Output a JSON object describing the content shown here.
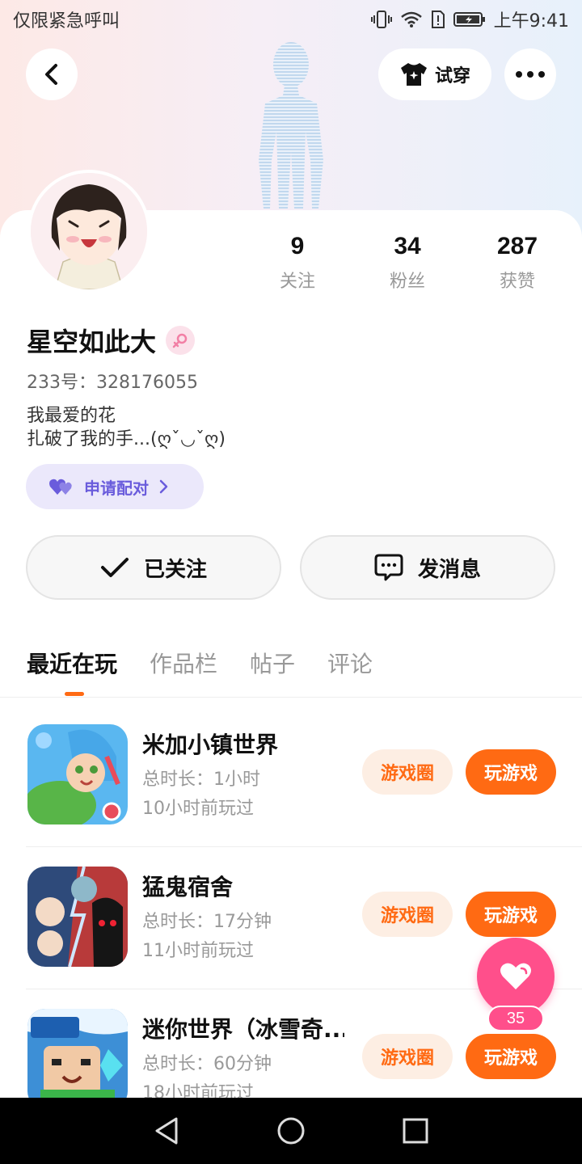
{
  "status_bar": {
    "carrier": "仅限紧急呼叫",
    "time": "上午9:41"
  },
  "header": {
    "back_icon": "chevron-left-icon",
    "try_on_label": "试穿",
    "more_icon": "more-dots-icon"
  },
  "profile": {
    "stats": [
      {
        "value": "9",
        "label": "关注"
      },
      {
        "value": "34",
        "label": "粉丝"
      },
      {
        "value": "287",
        "label": "获赞"
      }
    ],
    "nickname": "星空如此大",
    "gender_icon": "female-icon",
    "uid": "233号：328176055",
    "bio_line1": "我最爱的花",
    "bio_line2": "扎破了我的手...(ღˇ◡ˇღ)",
    "pair_label": "申请配对",
    "follow_label": "已关注",
    "message_label": "发消息"
  },
  "tabs": [
    {
      "label": "最近在玩",
      "active": true
    },
    {
      "label": "作品栏",
      "active": false
    },
    {
      "label": "帖子",
      "active": false
    },
    {
      "label": "评论",
      "active": false
    }
  ],
  "games": [
    {
      "title": "米加小镇世界",
      "duration": "总时长：1小时",
      "last_played": "10小时前玩过",
      "circle_label": "游戏圈",
      "play_label": "玩游戏"
    },
    {
      "title": "猛鬼宿舍",
      "duration": "总时长：17分钟",
      "last_played": "11小时前玩过",
      "circle_label": "游戏圈",
      "play_label": "玩游戏"
    },
    {
      "title": "迷你世界（冰雪奇...",
      "duration": "总时长：60分钟",
      "last_played": "18小时前玩过",
      "circle_label": "游戏圈",
      "play_label": "玩游戏"
    }
  ],
  "fab": {
    "icon": "heart-icon",
    "count": "35"
  },
  "colors": {
    "accent": "#ff6a13",
    "pink": "#ff4f8b",
    "purple": "#6a5cdc"
  }
}
